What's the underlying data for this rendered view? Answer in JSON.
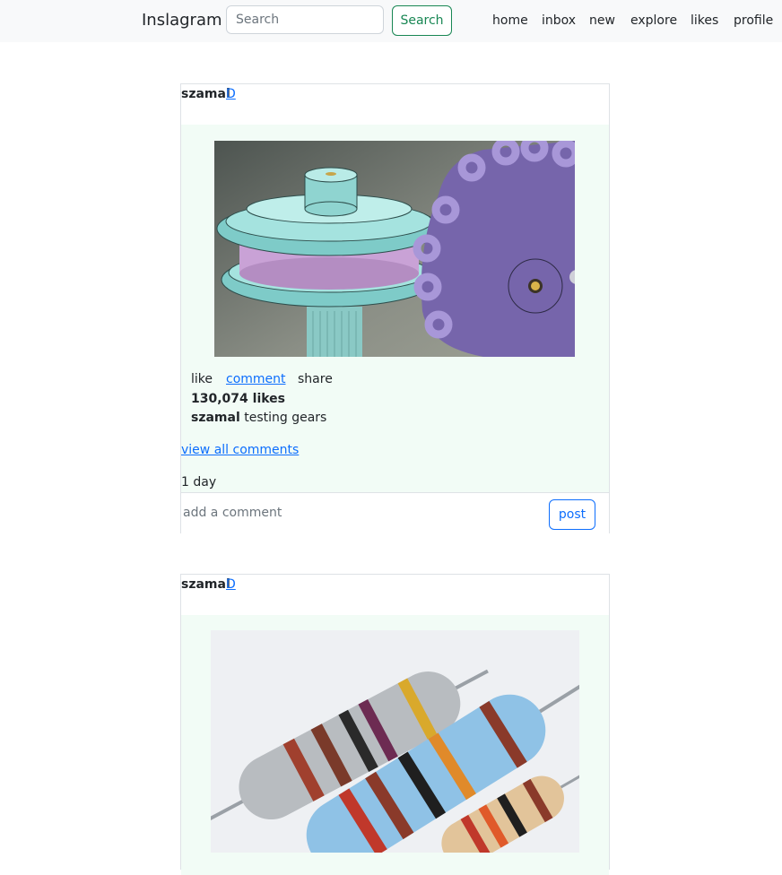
{
  "nav": {
    "brand": "Inslagram",
    "search_placeholder": "Search",
    "search_button": "Search",
    "links": [
      "home",
      "inbox",
      "new",
      "explore",
      "likes",
      "profile"
    ]
  },
  "posts": [
    {
      "username": "szamal",
      "user_link": "D",
      "image_alt": "gears",
      "actions": {
        "like": "like",
        "comment": "comment",
        "share": "share"
      },
      "likes": "130,074 likes",
      "caption_user": "szamal",
      "caption_text": "testing gears",
      "view_comments": "view all comments",
      "time": "1 day",
      "comment_placeholder": "add a comment",
      "post_button": "post"
    },
    {
      "username": "szamal",
      "user_link": "D",
      "image_alt": "resistors"
    }
  ],
  "colors": {
    "navbar_bg": "#f8f9fa",
    "post_body_bg": "#f2fcf6",
    "link": "#0d6efd",
    "search_button": "#198754"
  }
}
